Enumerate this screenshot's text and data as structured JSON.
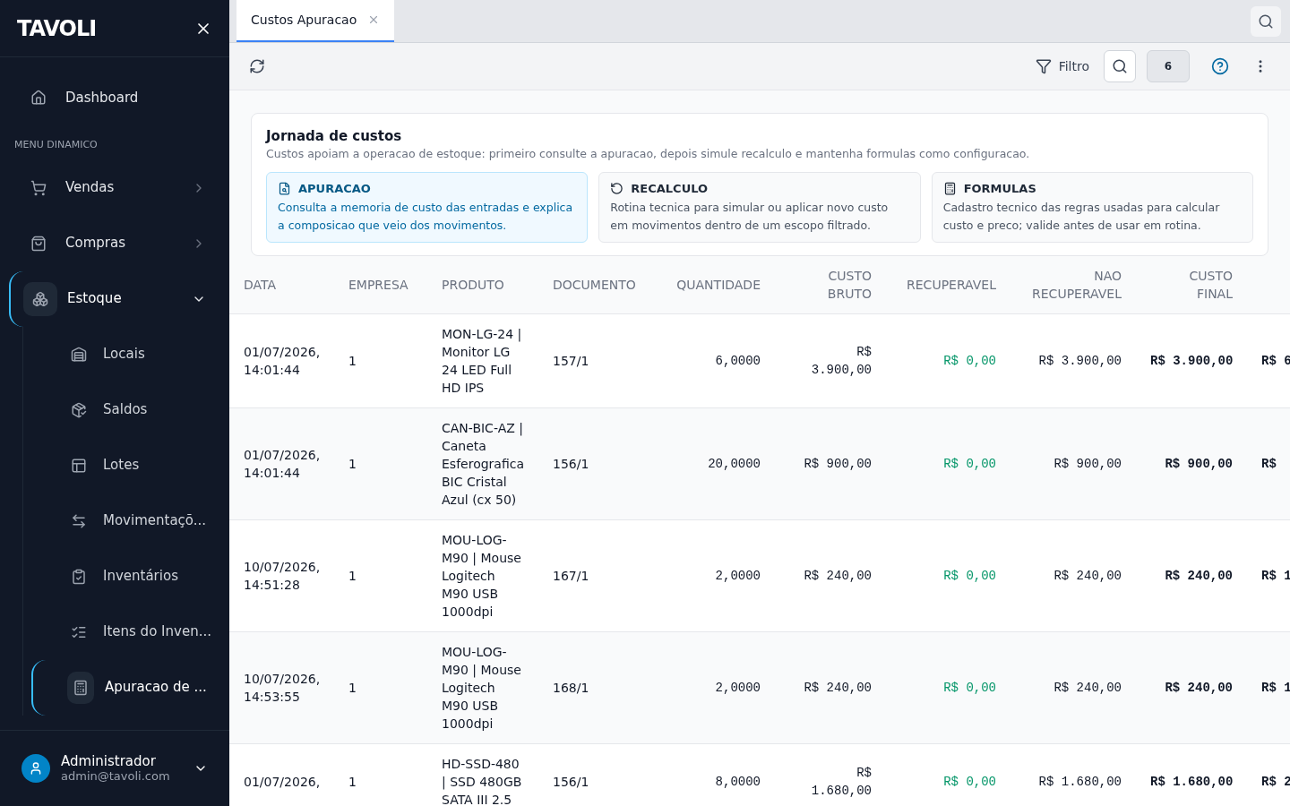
{
  "sidebar": {
    "logo": "TAVOLI",
    "items": [
      {
        "kind": "link",
        "label": "Dashboard",
        "selected": false
      },
      {
        "kind": "section",
        "label": "MENU DINAMICO"
      },
      {
        "kind": "group",
        "label": "Vendas",
        "selected": false,
        "expanded": false
      },
      {
        "kind": "group",
        "label": "Compras",
        "selected": false,
        "expanded": false
      },
      {
        "kind": "group",
        "label": "Estoque",
        "selected": true,
        "expanded": true,
        "children": [
          {
            "label": "Locais",
            "selected": false
          },
          {
            "label": "Saldos",
            "selected": false
          },
          {
            "label": "Lotes",
            "selected": false
          },
          {
            "label": "Movimentaçõ...",
            "selected": false
          },
          {
            "label": "Inventários",
            "selected": false
          },
          {
            "label": "Itens do Inven...",
            "selected": false
          },
          {
            "label": "Apuracao de ...",
            "selected": true
          }
        ]
      }
    ],
    "user": {
      "name": "Administrador",
      "email": "admin@tavoli.com"
    }
  },
  "tabs": [
    {
      "label": "Custos Apuracao",
      "selected": true
    }
  ],
  "toolbar": {
    "filter": "Filtro",
    "count": "6"
  },
  "journey": {
    "title": "Jornada de custos",
    "subtitle": "Custos apoiam a operacao de estoque: primeiro consulte a apuracao, depois simule recalculo e mantenha formulas como configuracao.",
    "cards": [
      {
        "title": "APURACAO",
        "text": "Consulta a memoria de custo das entradas e explica a composicao que veio dos movimentos.",
        "selected": true
      },
      {
        "title": "RECALCULO",
        "text": "Rotina tecnica para simular ou aplicar novo custo em movimentos dentro de um escopo filtrado.",
        "selected": false
      },
      {
        "title": "FORMULAS",
        "text": "Cadastro tecnico das regras usadas para calcular custo e preco; valide antes de usar em rotina.",
        "selected": false
      }
    ]
  },
  "table": {
    "columns": [
      "DATA",
      "EMPRESA",
      "PRODUTO",
      "DOCUMENTO",
      "QUANTIDADE",
      "CUSTO BRUTO",
      "RECUPERAVEL",
      "NAO RECUPERAVEL",
      "CUSTO FINAL"
    ],
    "rows": [
      [
        "01/07/2026, 14:01:44",
        "1",
        "MON-LG-24 | Monitor LG 24 LED Full HD IPS",
        "157/1",
        "6,0000",
        "R$ 3.900,00",
        "R$ 0,00",
        "R$ 3.900,00",
        "R$ 3.900,00",
        "R$ 6"
      ],
      [
        "01/07/2026, 14:01:44",
        "1",
        "CAN-BIC-AZ | Caneta Esferografica BIC Cristal Azul (cx 50)",
        "156/1",
        "20,0000",
        "R$ 900,00",
        "R$ 0,00",
        "R$ 900,00",
        "R$ 900,00",
        "R$"
      ],
      [
        "10/07/2026, 14:51:28",
        "1",
        "MOU-LOG-M90 | Mouse Logitech M90 USB 1000dpi",
        "167/1",
        "2,0000",
        "R$ 240,00",
        "R$ 0,00",
        "R$ 240,00",
        "R$ 240,00",
        "R$ 1"
      ],
      [
        "10/07/2026, 14:53:55",
        "1",
        "MOU-LOG-M90 | Mouse Logitech M90 USB 1000dpi",
        "168/1",
        "2,0000",
        "R$ 240,00",
        "R$ 0,00",
        "R$ 240,00",
        "R$ 240,00",
        "R$ 1"
      ],
      [
        "01/07/2026,",
        "1",
        "HD-SSD-480 | SSD 480GB SATA III 2.5",
        "156/1",
        "8,0000",
        "R$ 1.680,00",
        "R$ 0,00",
        "R$ 1.680,00",
        "R$ 1.680,00",
        "R$ 2"
      ]
    ]
  }
}
